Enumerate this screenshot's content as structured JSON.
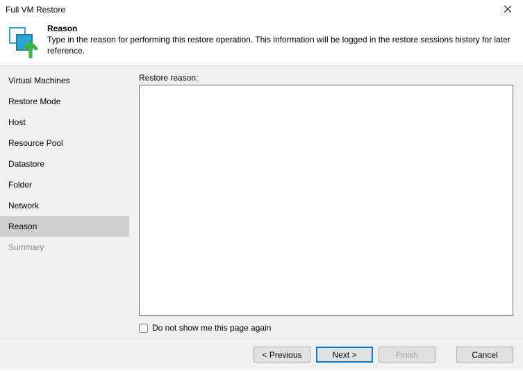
{
  "window": {
    "title": "Full VM Restore"
  },
  "header": {
    "heading": "Reason",
    "description": "Type in the reason for performing this restore operation. This information will be logged in the restore sessions history for later reference."
  },
  "sidebar": {
    "items": [
      {
        "label": "Virtual Machines",
        "selected": false,
        "disabled": false
      },
      {
        "label": "Restore Mode",
        "selected": false,
        "disabled": false
      },
      {
        "label": "Host",
        "selected": false,
        "disabled": false
      },
      {
        "label": "Resource Pool",
        "selected": false,
        "disabled": false
      },
      {
        "label": "Datastore",
        "selected": false,
        "disabled": false
      },
      {
        "label": "Folder",
        "selected": false,
        "disabled": false
      },
      {
        "label": "Network",
        "selected": false,
        "disabled": false
      },
      {
        "label": "Reason",
        "selected": true,
        "disabled": false
      },
      {
        "label": "Summary",
        "selected": false,
        "disabled": true
      }
    ]
  },
  "main": {
    "reason_label": "Restore reason:",
    "reason_value": "",
    "checkbox_label": "Do not show me this page again",
    "checkbox_checked": false
  },
  "footer": {
    "previous": "< Previous",
    "next": "Next >",
    "finish": "Finish",
    "cancel": "Cancel"
  }
}
